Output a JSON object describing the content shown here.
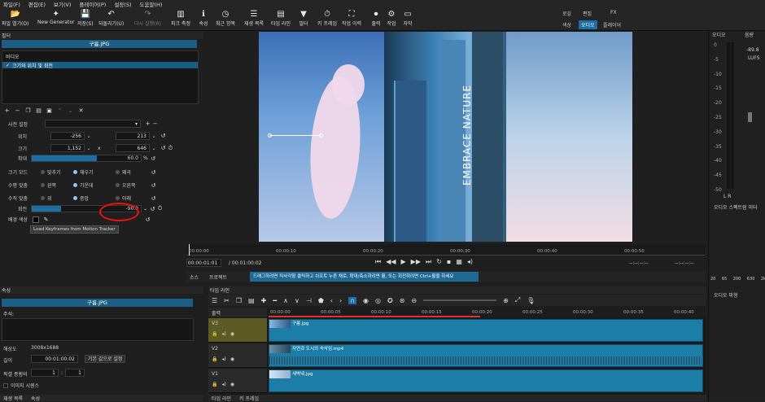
{
  "menu": [
    "파일(F)",
    "편집(E)",
    "보기(V)",
    "플레이어(P)",
    "설정(S)",
    "도움말(H)"
  ],
  "toolbar": [
    {
      "label": "파일 열기(O)",
      "icon": "folder-open-icon"
    },
    {
      "label": "New Generator",
      "icon": "new-generator-icon"
    },
    {
      "label": "저장(S)",
      "icon": "save-icon"
    },
    {
      "label": "되돌리기(U)",
      "icon": "undo-icon"
    },
    {
      "label": "다시 실행(R)",
      "icon": "redo-icon"
    },
    {
      "label": "피크 측정",
      "icon": "peak-meter-icon"
    },
    {
      "label": "속성",
      "icon": "info-icon"
    },
    {
      "label": "최근 항목",
      "icon": "recent-icon"
    },
    {
      "label": "재생 목록",
      "icon": "playlist-icon"
    },
    {
      "label": "타임 라인",
      "icon": "timeline-icon"
    },
    {
      "label": "필터",
      "icon": "filter-icon"
    },
    {
      "label": "키 프레임",
      "icon": "keyframes-icon"
    },
    {
      "label": "작업 이력",
      "icon": "history-icon"
    },
    {
      "label": "출력",
      "icon": "export-icon"
    },
    {
      "label": "작업",
      "icon": "jobs-icon"
    },
    {
      "label": "자막",
      "icon": "subtitles-icon"
    }
  ],
  "workspaces": {
    "row1": [
      "로깅",
      "편집",
      "FX"
    ],
    "row2": [
      "색상",
      "오디오",
      "플레이어"
    ],
    "active": "오디오"
  },
  "filters": {
    "panel_label": "필터",
    "clip_name": "구름.JPG",
    "section": "비디오",
    "filter_item": "크기와 위치 및 회전",
    "preset_label": "사전 설정",
    "position_label": "위치",
    "position_x": "-256",
    "position_y": "213",
    "size_label": "크기",
    "size_w": "1,152",
    "size_sep": "x",
    "size_h": "646",
    "zoom_label": "확대",
    "zoom_value": "60.0",
    "zoom_unit": "%",
    "zoom_fraction": 0.6,
    "size_mode_label": "크기 모드",
    "size_mode_options": [
      "맞추기",
      "채우기",
      "왜곡"
    ],
    "size_mode_selected": 1,
    "h_align_label": "수평 맞춤",
    "h_align_options": [
      "왼쪽",
      "가운데",
      "오른쪽"
    ],
    "h_align_selected": 1,
    "v_align_label": "수직 맞춤",
    "v_align_options": [
      "위",
      "중앙",
      "아래"
    ],
    "v_align_selected": 1,
    "rotation_label": "회전",
    "rotation_value": "-90.0",
    "bg_color_label": "배경 색상",
    "tooltip": "Load Keyframes from Motion Tracker"
  },
  "properties": {
    "panel_label": "속성",
    "clip_name": "구름.JPG",
    "comments_label": "주석:",
    "resolution_label": "해상도",
    "resolution_value": "3008x1688",
    "duration_label": "길이",
    "duration_value": "00:01:00:02",
    "default_duration_button": "기본 값으로 설정",
    "aspect_label": "픽셀 종횡비",
    "aspect_num": "1",
    "aspect_sep": ":",
    "aspect_den": "1",
    "sequence_label": "이미지 시퀀스",
    "bottom_tabs": [
      "재생 목록",
      "속성"
    ]
  },
  "player": {
    "ruler_ticks": [
      "00:00:00",
      "00:00:10",
      "00:00:20",
      "00:00:30",
      "00:00:40",
      "00:00:50"
    ],
    "current_time": "00:00:01:01",
    "total_time": "/ 00:01:00:02",
    "in_point": "--:--:--:--",
    "out_point": "--:--:--:--",
    "tabs": [
      "소스",
      "프로젝트"
    ],
    "hint": "드래그하려면 직사각형 클릭하고 쉬프트 누른 채로, 확대/축소하려면 휠, 또는 회전하려면 Ctrl+휠을 하세요",
    "overlay_text": "EMBRACE NATURE"
  },
  "timeline": {
    "panel_label": "타임 라인",
    "output_label": "출력",
    "ruler_ticks": [
      "00:00:00",
      "00:00:05",
      "00:00:10",
      "00:00:15",
      "00:00:20",
      "00:00:25",
      "00:00:30",
      "00:00:35",
      "00:00:40"
    ],
    "tracks": [
      {
        "name": "V3",
        "clip": "구름.jpg"
      },
      {
        "name": "V2",
        "clip": "자연과 도시의 속삭임.mp4"
      },
      {
        "name": "V1",
        "clip": "새벽녘.jpg"
      }
    ],
    "bottom_tabs": [
      "타임 라인",
      "키 프레임"
    ]
  },
  "meters": {
    "left_label": "오디오",
    "right_label": "음량",
    "peak_value": "-89.8",
    "unit": "LUFS",
    "scale": [
      "0",
      "-5",
      "-10",
      "-15",
      "-20",
      "-25",
      "-30",
      "-35",
      "-40",
      "-45",
      "-50"
    ],
    "lr": "L R",
    "spectrum_label": "오디오 스펙트럼 미터",
    "freq_ticks": [
      "20",
      "65",
      "200",
      "630",
      "2k"
    ],
    "waveform_label": "오디오 파형"
  }
}
